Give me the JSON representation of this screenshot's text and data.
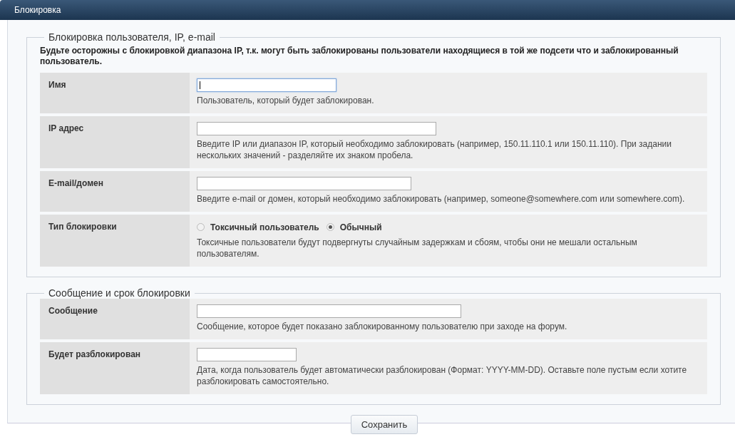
{
  "header": {
    "title": "Блокировка"
  },
  "sections": [
    {
      "legend": "Блокировка пользователя, IP, e-mail",
      "warning": "Будьте осторожны с блокировкой диапазона IP, т.к. могут быть заблокированы пользователи находящиеся в той же подсети что и заблокированный пользователь.",
      "rows": [
        {
          "kind": "text",
          "label": "Имя",
          "focused": true,
          "hint": "Пользователь, который будет заблокирован."
        },
        {
          "kind": "text",
          "label": "IP адрес",
          "focused": false,
          "hint": "Введите IP или диапазон IP, который необходимо заблокировать (например, 150.11.110.1 или 150.11.110). При задании нескольких значений - разделяйте их знаком пробела."
        },
        {
          "kind": "text",
          "label": "E-mail/домен",
          "focused": false,
          "hint": "Введите e-mail or домен, который необходимо заблокировать (например, someone@somewhere.com или somewhere.com)."
        },
        {
          "kind": "radio",
          "label": "Тип блокировки",
          "options": [
            {
              "label": "Токсичный пользователь",
              "selected": false
            },
            {
              "label": "Обычный",
              "selected": true
            }
          ],
          "hint": "Токсичные пользователи будут подвергнуты случайным задержкам и сбоям, чтобы они не мешали остальным пользователям."
        }
      ]
    },
    {
      "legend": "Сообщение и срок блокировки",
      "rows": [
        {
          "kind": "text",
          "label": "Сообщение",
          "focused": false,
          "hint": "Сообщение, которое будет показано заблокированному пользователю при заходе на форум."
        },
        {
          "kind": "text",
          "label": "Будет разблокирован",
          "focused": false,
          "hint": "Дата, когда пользователь будет автоматически разблокирован (Формат: YYYY-MM-DD). Оставьте поле пустым если хотите разблокировать самостоятельно."
        }
      ]
    }
  ],
  "save_button": "Сохранить"
}
